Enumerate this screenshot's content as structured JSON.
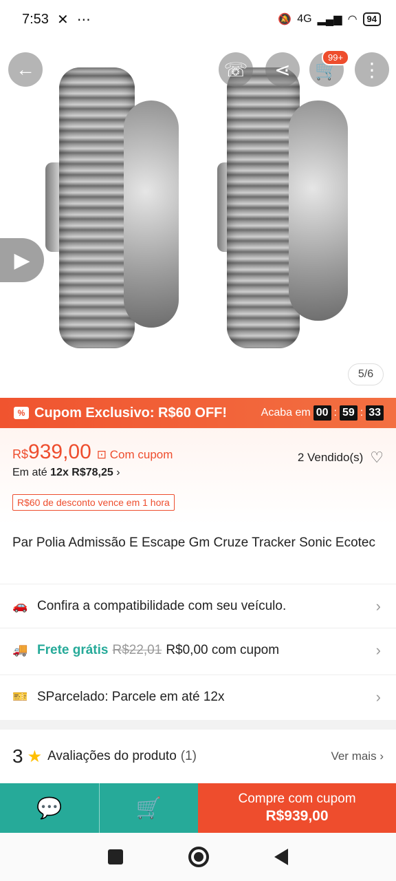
{
  "status_bar": {
    "time": "7:53",
    "network": "4G",
    "battery": "94"
  },
  "gallery": {
    "counter": "5/6",
    "cart_badge": "99+"
  },
  "coupon_banner": {
    "title": "Cupom Exclusivo: R$60 OFF!",
    "ends_label": "Acaba em",
    "hours": "00",
    "minutes": "59",
    "seconds": "33"
  },
  "price": {
    "currency": "R$",
    "value": "939,00",
    "coupon_label": "Com cupom",
    "installments_prefix": "Em até",
    "installments_value": "12x R$78,25",
    "sold": "2 Vendido(s)",
    "discount_tag": "R$60 de desconto vence em 1 hora"
  },
  "product": {
    "title": "Par Polia Admissão E Escape Gm Cruze Tracker Sonic Ecotec"
  },
  "rows": {
    "compat": "Confira a compatibilidade com seu veículo.",
    "shipping_free": "Frete grátis",
    "shipping_old": "R$22,01",
    "shipping_new": "R$0,00 com cupom",
    "parcelado": "SParcelado: Parcele em até 12x"
  },
  "reviews": {
    "score": "3",
    "label": "Avaliações do produto",
    "count": "(1)",
    "more": "Ver mais"
  },
  "bottom_bar": {
    "buy_line1": "Compre com cupom",
    "buy_line2": "R$939,00"
  },
  "colors": {
    "accent": "#ee4d2d",
    "teal": "#26aa99"
  }
}
